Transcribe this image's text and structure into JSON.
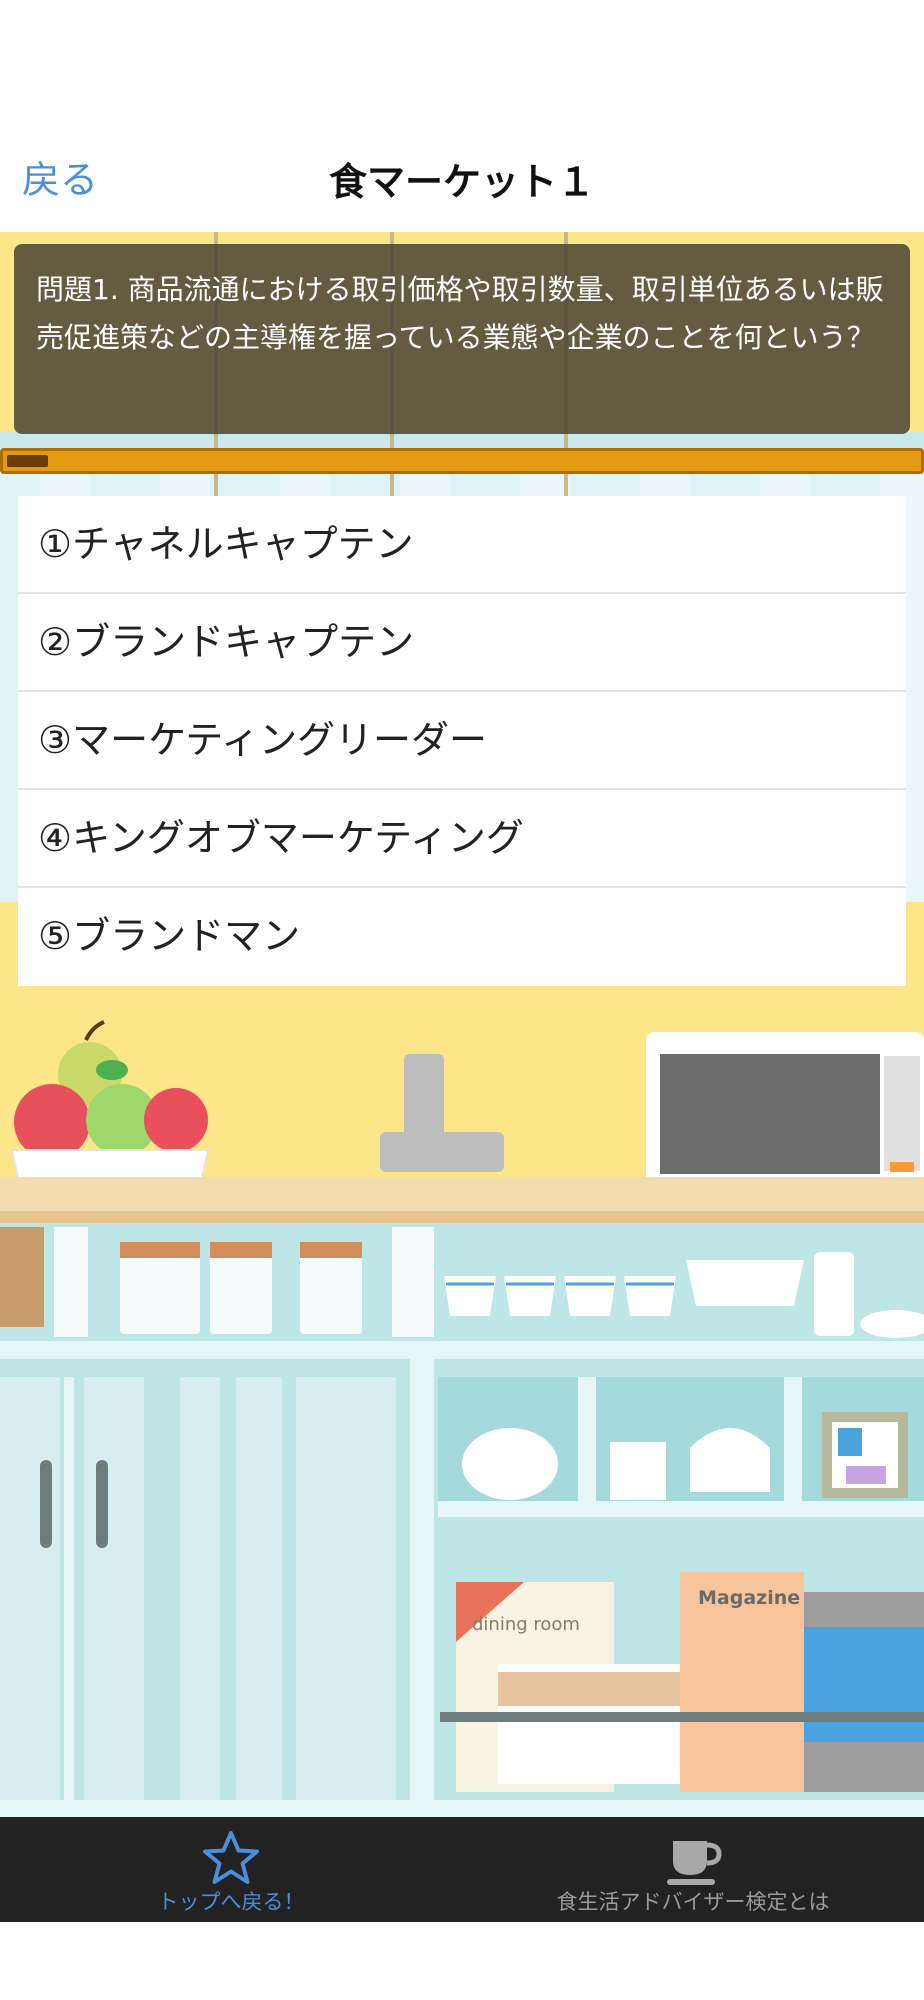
{
  "nav": {
    "back_label": "戻る",
    "title": "食マーケット１"
  },
  "question": {
    "text": "問題1. 商品流通における取引価格や取引数量、取引単位あるいは販売促進策などの主導権を握っている業態や企業のことを何という？"
  },
  "progress": {
    "fraction": 0.045
  },
  "answers": [
    {
      "label": "①チャネルキャプテン"
    },
    {
      "label": "②ブランドキャプテン"
    },
    {
      "label": "③マーケティングリーダー"
    },
    {
      "label": "④キングオブマーケティング"
    },
    {
      "label": "⑤ブランドマン"
    }
  ],
  "scene": {
    "book_title": "dining room",
    "magazine_title": "Magazine"
  },
  "tabbar": {
    "tabs": [
      {
        "label": "トップへ戻る！",
        "icon": "star-icon",
        "active": true
      },
      {
        "label": "食生活アドバイザー検定とは",
        "icon": "coffee-cup-icon",
        "active": false
      }
    ]
  },
  "colors": {
    "accent": "#4a90d9",
    "scene_background": "#fde58a",
    "progress": "#e39a12",
    "tabbar_background": "#222222"
  }
}
